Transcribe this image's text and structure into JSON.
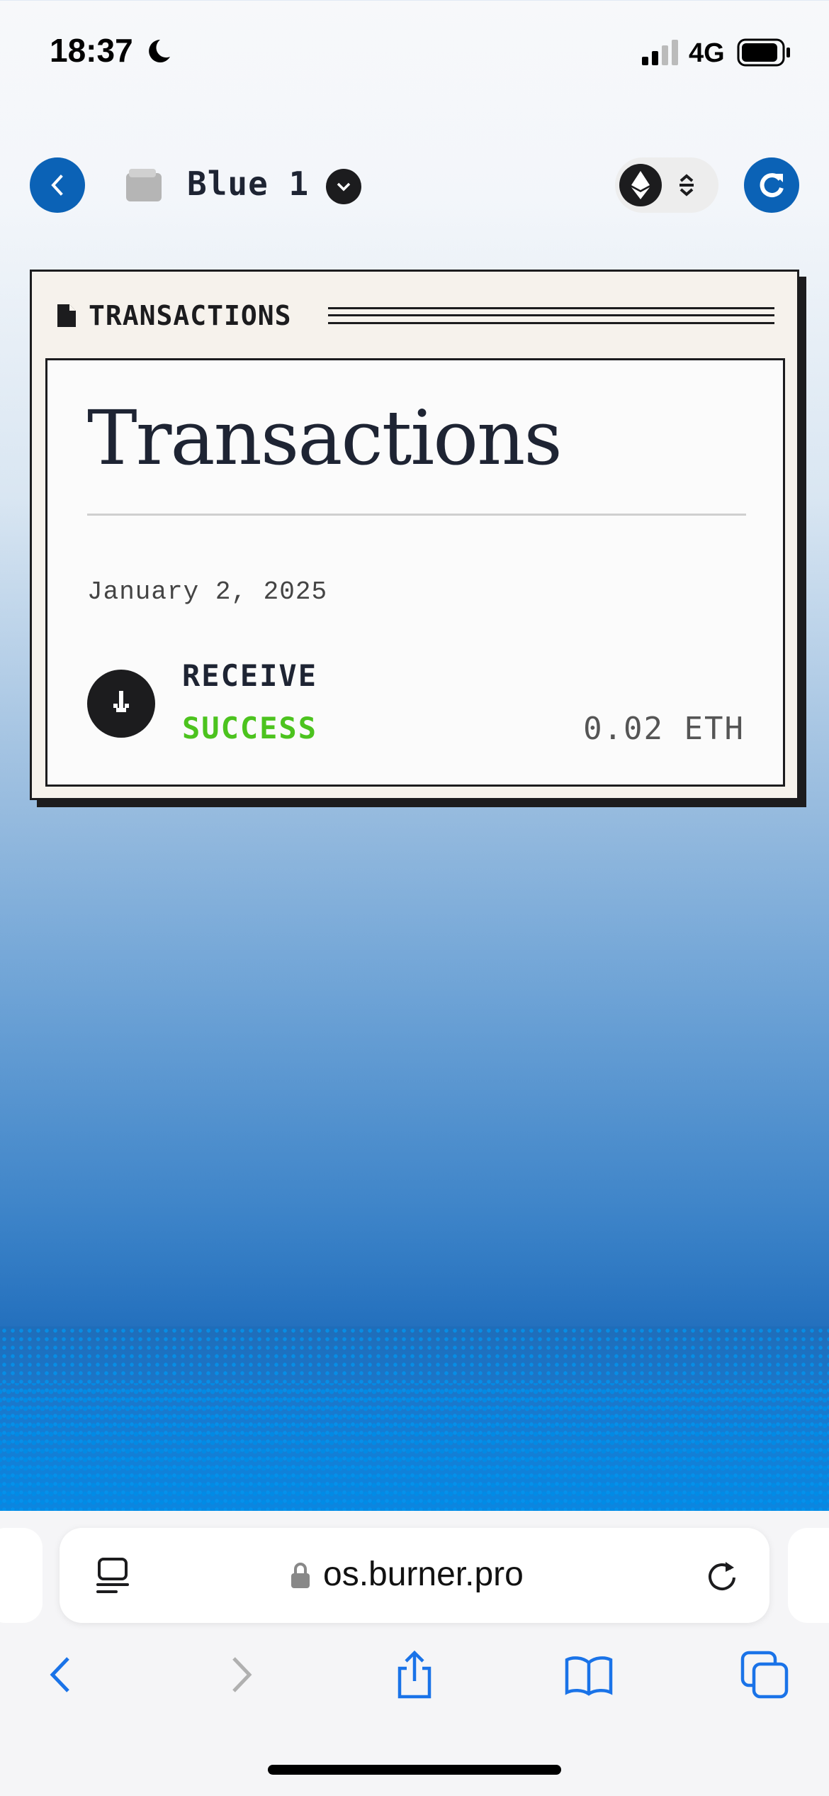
{
  "status_bar": {
    "time": "18:37",
    "network": "4G"
  },
  "header": {
    "wallet_name": "Blue 1"
  },
  "card": {
    "label": "TRANSACTIONS",
    "title": "Transactions",
    "date": "January 2, 2025",
    "transactions": [
      {
        "type": "RECEIVE",
        "status": "SUCCESS",
        "amount": "0.02 ETH"
      }
    ]
  },
  "browser": {
    "url": "os.burner.pro"
  },
  "colors": {
    "accent": "#0b62b6",
    "success": "#4cc31e",
    "ink": "#1c1c1e",
    "card_bg": "#f6f2ec"
  }
}
